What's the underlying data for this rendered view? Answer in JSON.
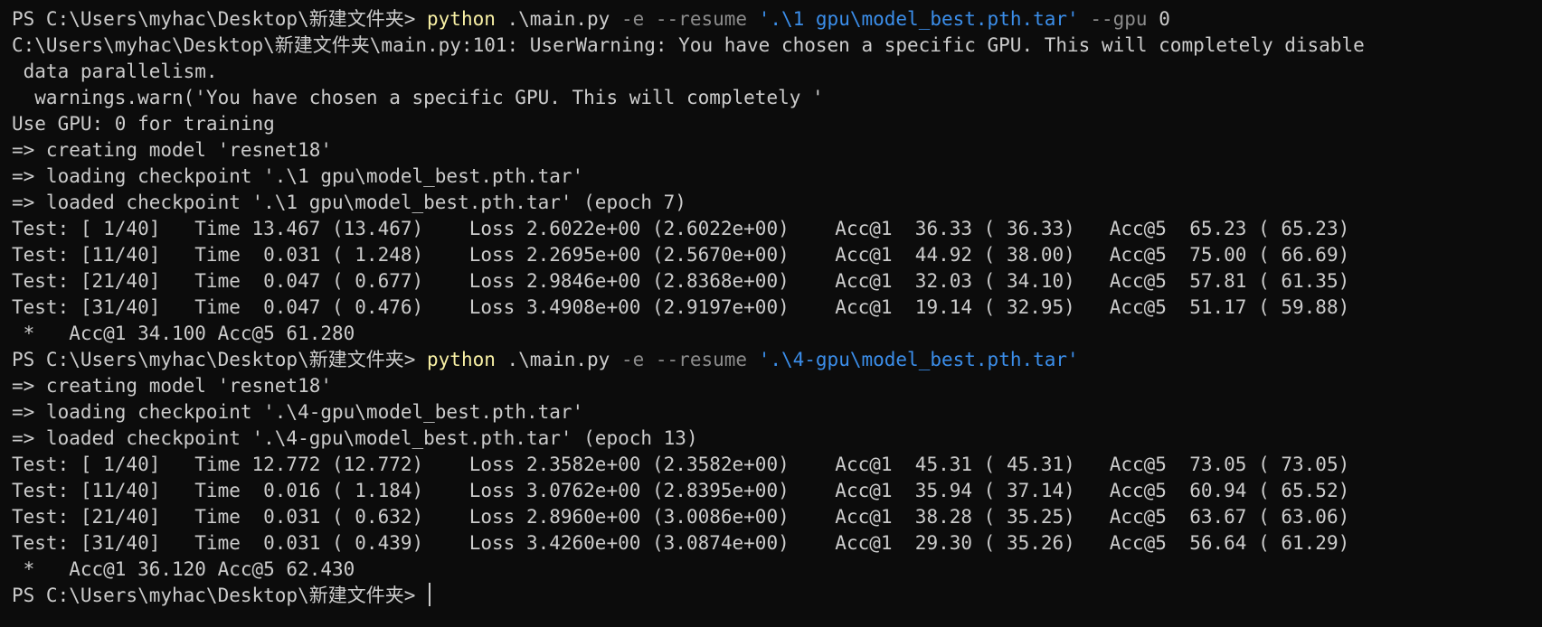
{
  "terminal": {
    "prompt": "PS C:\\Users\\myhac\\Desktop\\新建文件夹> ",
    "command1": {
      "exe": "python",
      "script": " .\\main.py ",
      "flag_e": "-e",
      "flag_resume": " --resume ",
      "path": "'.\\1 gpu\\model_best.pth.tar'",
      "flag_gpu": " --gpu ",
      "gpu_value": "0"
    },
    "command2": {
      "exe": "python",
      "script": " .\\main.py ",
      "flag_e": "-e",
      "flag_resume": " --resume ",
      "path": "'.\\4-gpu\\model_best.pth.tar'"
    },
    "output1": [
      "C:\\Users\\myhac\\Desktop\\新建文件夹\\main.py:101: UserWarning: You have chosen a specific GPU. This will completely disable",
      " data parallelism.",
      "  warnings.warn('You have chosen a specific GPU. This will completely '",
      "Use GPU: 0 for training",
      "=> creating model 'resnet18'",
      "=> loading checkpoint '.\\1 gpu\\model_best.pth.tar'",
      "=> loaded checkpoint '.\\1 gpu\\model_best.pth.tar' (epoch 7)",
      "Test: [ 1/40]   Time 13.467 (13.467)    Loss 2.6022e+00 (2.6022e+00)    Acc@1  36.33 ( 36.33)   Acc@5  65.23 ( 65.23)",
      "Test: [11/40]   Time  0.031 ( 1.248)    Loss 2.2695e+00 (2.5670e+00)    Acc@1  44.92 ( 38.00)   Acc@5  75.00 ( 66.69)",
      "Test: [21/40]   Time  0.047 ( 0.677)    Loss 2.9846e+00 (2.8368e+00)    Acc@1  32.03 ( 34.10)   Acc@5  57.81 ( 61.35)",
      "Test: [31/40]   Time  0.047 ( 0.476)    Loss 3.4908e+00 (2.9197e+00)    Acc@1  19.14 ( 32.95)   Acc@5  51.17 ( 59.88)",
      " *   Acc@1 34.100 Acc@5 61.280"
    ],
    "output2": [
      "=> creating model 'resnet18'",
      "=> loading checkpoint '.\\4-gpu\\model_best.pth.tar'",
      "=> loaded checkpoint '.\\4-gpu\\model_best.pth.tar' (epoch 13)",
      "Test: [ 1/40]   Time 12.772 (12.772)    Loss 2.3582e+00 (2.3582e+00)    Acc@1  45.31 ( 45.31)   Acc@5  73.05 ( 73.05)",
      "Test: [11/40]   Time  0.016 ( 1.184)    Loss 3.0762e+00 (2.8395e+00)    Acc@1  35.94 ( 37.14)   Acc@5  60.94 ( 65.52)",
      "Test: [21/40]   Time  0.031 ( 0.632)    Loss 2.8960e+00 (3.0086e+00)    Acc@1  38.28 ( 35.25)   Acc@5  63.67 ( 63.06)",
      "Test: [31/40]   Time  0.031 ( 0.439)    Loss 3.4260e+00 (3.0874e+00)    Acc@1  29.30 ( 35.26)   Acc@5  56.64 ( 61.29)",
      " *   Acc@1 36.120 Acc@5 62.430"
    ],
    "colors": {
      "background": "#0c0c0c",
      "foreground": "#cccccc",
      "command": "#f9f1a5",
      "argument": "#8c8c8c",
      "string": "#3b8eea"
    }
  }
}
